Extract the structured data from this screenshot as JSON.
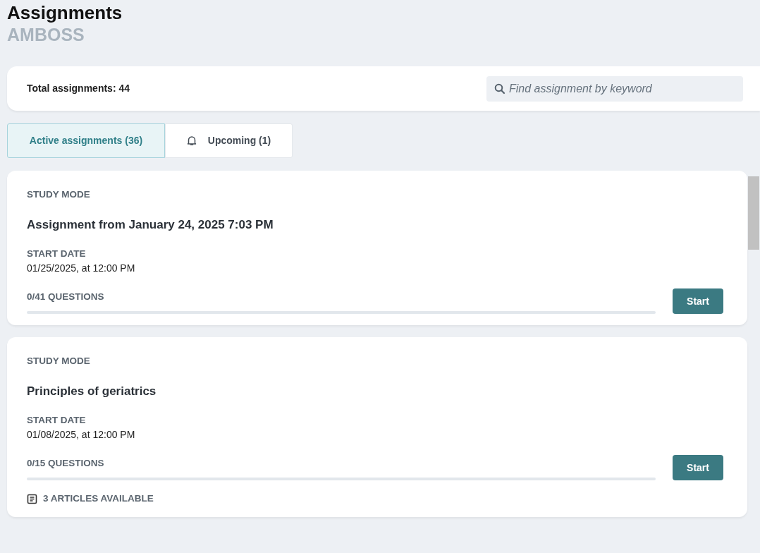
{
  "header": {
    "title": "Assignments",
    "subtitle": "AMBOSS"
  },
  "summary": {
    "total": "Total assignments: 44",
    "search": {
      "placeholder": "Find assignment by keyword"
    }
  },
  "tabs": [
    {
      "label": "Active assignments (36)",
      "selected": true,
      "kind": "plain"
    },
    {
      "label": "Upcoming (1)",
      "selected": false,
      "kind": "bell"
    }
  ],
  "assignments": [
    {
      "mode": "STUDY MODE",
      "title": "Assignment from January 24, 2025 7:03 PM",
      "date_label": "START DATE",
      "date": "01/25/2025, at 12:00 PM",
      "progress": "0/41 QUESTIONS",
      "level": 0,
      "button": "Start"
    },
    {
      "mode": "STUDY MODE",
      "title": "Principles of geriatrics",
      "date_label": "START DATE",
      "date": "01/08/2025, at 12:00 PM",
      "progress": "0/15 QUESTIONS",
      "level": 0,
      "button": "Start",
      "articles": "3 ARTICLES AVAILABLE"
    }
  ]
}
